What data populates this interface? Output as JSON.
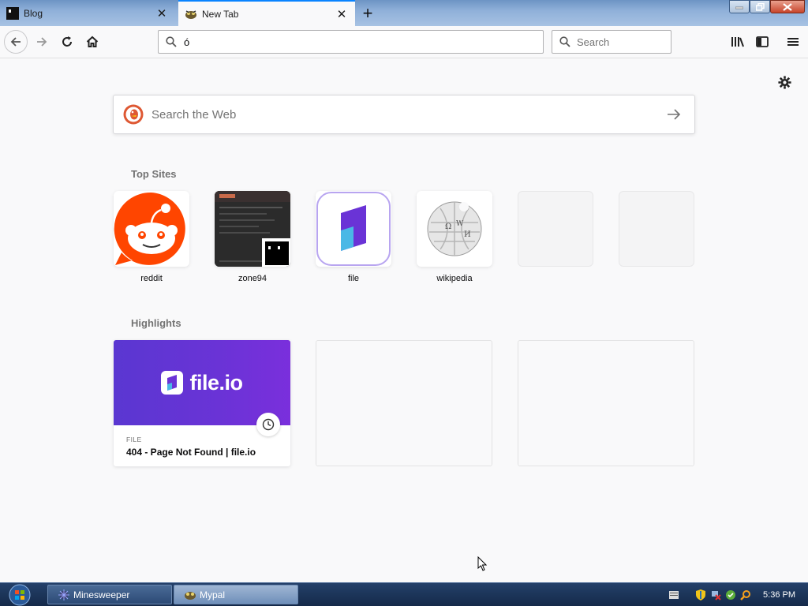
{
  "tabs": [
    {
      "title": "Blog",
      "icon": "blog-favicon",
      "active": false
    },
    {
      "title": "New Tab",
      "icon": "mypal-favicon",
      "active": true
    }
  ],
  "navbar": {
    "url_value": "ó",
    "search_placeholder": "Search"
  },
  "content": {
    "websearch_placeholder": "Search the Web",
    "top_sites_title": "Top Sites",
    "highlights_title": "Highlights",
    "top_sites": [
      {
        "label": "reddit"
      },
      {
        "label": "zone94"
      },
      {
        "label": "file"
      },
      {
        "label": "wikipedia"
      },
      {
        "label": ""
      },
      {
        "label": ""
      }
    ],
    "highlights": [
      {
        "hero_text": "file.io",
        "type": "FILE",
        "title": "404 - Page Not Found | file.io"
      }
    ]
  },
  "taskbar": {
    "tasks": [
      {
        "label": "Minesweeper",
        "icon": "minesweeper-icon"
      },
      {
        "label": "Mypal",
        "icon": "mypal-icon"
      }
    ],
    "clock": "5:36 PM"
  },
  "colors": {
    "accent": "#0a84ff",
    "reddit_orange": "#ff4500",
    "fileio_purple": "#6a33d6"
  }
}
